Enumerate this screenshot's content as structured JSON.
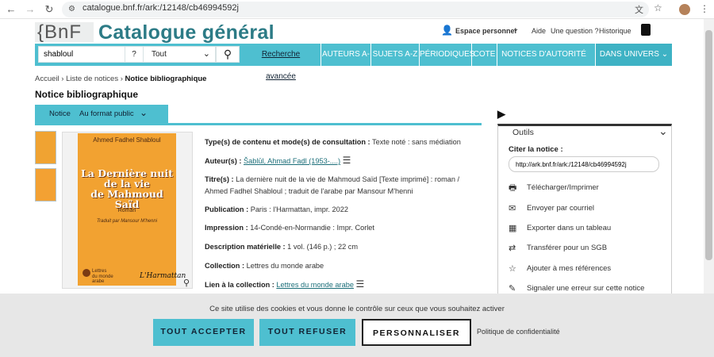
{
  "browser": {
    "url": "catalogue.bnf.fr/ark:/12148/cb46994592j"
  },
  "header": {
    "logo_bnf": "{BnF",
    "logo_title": "Catalogue général",
    "account": "Espace personnel",
    "help": "Aide",
    "question": "Une question ?",
    "history": "Historique"
  },
  "search": {
    "value": "shabloul",
    "scope": "Tout",
    "advanced": "Recherche avancée",
    "help_icon": "?"
  },
  "nav": {
    "items": [
      "AUTEURS A-Z",
      "SUJETS A-Z",
      "PÉRIODIQUES",
      "COTE",
      "NOTICES D'AUTORITÉ",
      "DANS UNIVERS"
    ]
  },
  "breadcrumb": {
    "home": "Accueil",
    "list": "Liste de notices",
    "current": "Notice bibliographique"
  },
  "page_title": "Notice bibliographique",
  "tabs": {
    "notice": "Notice",
    "format": "Au format public"
  },
  "cover": {
    "author": "Ahmed Fadhel Shabloul",
    "title_l1": "La Dernière nuit",
    "title_l2": "de la vie",
    "title_l3": "de Mahmoud Saïd",
    "genre": "Roman",
    "translator": "Traduit par Mansour M'henni",
    "collection_l1": "Lettres",
    "collection_l2": "du monde",
    "collection_l3": "arabe",
    "publisher": "L'Harmattan"
  },
  "record": {
    "type_label": "Type(s) de contenu et mode(s) de consultation :",
    "type_value": "Texte noté : sans médiation",
    "author_label": "Auteur(s) :",
    "author_value": "Šablūl, Aḥmad Faḍl (1953-....)",
    "title_label": "Titre(s) :",
    "title_value": "La dernière nuit de la vie de Mahmoud Saïd [Texte imprimé] : roman / Ahmed Fadhel Shabloul ; traduit de l'arabe par Mansour M'henni",
    "pub_label": "Publication :",
    "pub_value": "Paris : l'Harmattan, impr. 2022",
    "print_label": "Impression :",
    "print_value": "14-Condé-en-Normandie : Impr. Corlet",
    "desc_label": "Description matérielle :",
    "desc_value": "1 vol. (146 p.) ; 22 cm",
    "coll_label": "Collection :",
    "coll_value": "Lettres du monde arabe",
    "link_label": "Lien à la collection :",
    "link_value": "Lettres du monde arabe"
  },
  "tools": {
    "title": "Outils",
    "cite_label": "Citer la notice :",
    "cite_url": "http://ark.bnf.fr/ark:/12148/cb46994592j",
    "items": [
      "Télécharger/Imprimer",
      "Envoyer par courriel",
      "Exporter dans un tableau",
      "Transférer pour un SGB",
      "Ajouter à mes références",
      "Signaler une erreur sur cette notice"
    ]
  },
  "cookie": {
    "message": "Ce site utilise des cookies et vous donne le contrôle sur ceux que vous souhaitez activer",
    "accept": "TOUT ACCEPTER",
    "refuse": "TOUT REFUSER",
    "customize": "PERSONNALISER",
    "policy": "Politique de confidentialité"
  },
  "colors": {
    "accent": "#4ebfd0",
    "brand": "#2c7b86",
    "cover": "#f2a231"
  }
}
